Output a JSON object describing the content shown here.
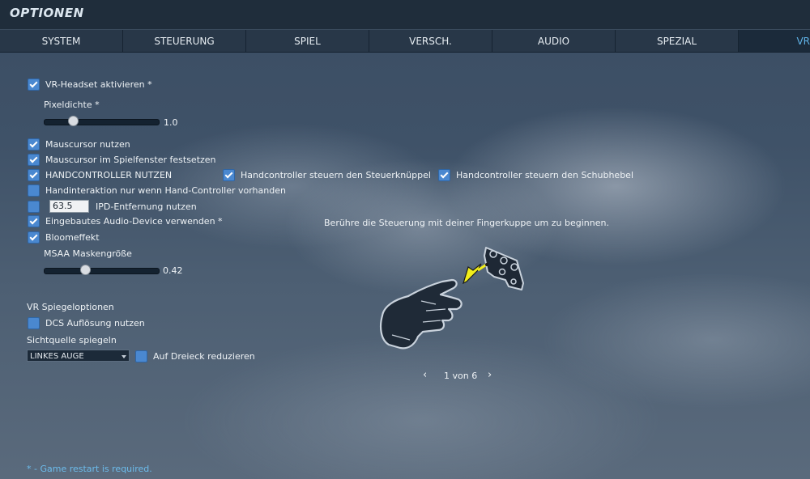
{
  "title": "OPTIONEN",
  "tabs": [
    {
      "label": "SYSTEM"
    },
    {
      "label": "STEUERUNG"
    },
    {
      "label": "SPIEL"
    },
    {
      "label": "VERSCH."
    },
    {
      "label": "AUDIO"
    },
    {
      "label": "SPEZIAL"
    },
    {
      "label": "VR",
      "active": true
    }
  ],
  "options": {
    "vr_headset": {
      "label": "VR-Headset aktivieren *",
      "checked": true
    },
    "pixel_density": {
      "label": "Pixeldichte *",
      "value": "1.0"
    },
    "mouse_cursor": {
      "label": "Mauscursor nutzen",
      "checked": true
    },
    "mouse_cursor_lock": {
      "label": "Mauscursor im Spielfenster festsetzen",
      "checked": true
    },
    "hand_controllers": {
      "label": "HANDCONTROLLER NUTZEN",
      "checked": true
    },
    "hc_stick": {
      "label": "Handcontroller steuern den Steuerknüppel",
      "checked": true
    },
    "hc_throttle": {
      "label": "Handcontroller steuern den Schubhebel",
      "checked": true
    },
    "hand_interaction": {
      "label": "Handinteraktion nur wenn Hand-Controller vorhanden",
      "checked": false
    },
    "ipd": {
      "label": "IPD-Entfernung nutzen",
      "value": "63.5",
      "checked": false
    },
    "audio_device": {
      "label": "Eingebautes Audio-Device verwenden *",
      "checked": true
    },
    "bloom": {
      "label": "Bloomeffekt",
      "checked": true
    },
    "msaa": {
      "label": "MSAA Maskengröße",
      "value": "0.42"
    }
  },
  "mirror": {
    "heading": "VR Spiegeloptionen",
    "dcs_resolution": {
      "label": "DCS Auflösung nutzen",
      "checked": false
    },
    "source_label": "Sichtquelle spiegeln",
    "source_value": "LINKES AUGE",
    "triangle": {
      "label": "Auf Dreieck reduzieren",
      "checked": false
    }
  },
  "tutorial": {
    "instruction": "Berühre die Steuerung mit deiner Fingerkuppe um zu beginnen.",
    "page": "1 von 6",
    "prev_icon": "chevron-left-icon",
    "next_icon": "chevron-right-icon"
  },
  "footnote": "* - Game restart is required.",
  "colors": {
    "accent": "#5fb2e6",
    "checkbox": "#4a88d0",
    "arrow": "#f2ee1a"
  }
}
